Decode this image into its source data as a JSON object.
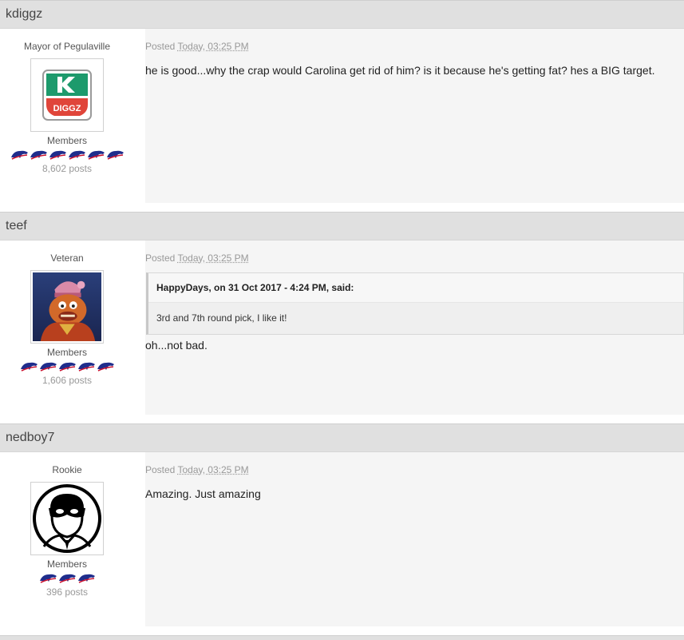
{
  "posts": [
    {
      "username": "kdiggz",
      "rank": "Mayor of Pegulaville",
      "avatar_icon": "kdiggz-logo-icon",
      "group": "Members",
      "pips": 6,
      "postcount": "8,602 posts",
      "posted_label": "Posted",
      "posted_time": "Today, 03:25 PM",
      "message": "he is good...why the crap would Carolina get rid of him?  is it because he's getting fat?  hes a BIG target."
    },
    {
      "username": "teef",
      "rank": "Veteran",
      "avatar_icon": "muppet-avatar-icon",
      "group": "Members",
      "pips": 5,
      "postcount": "1,606 posts",
      "posted_label": "Posted",
      "posted_time": "Today, 03:25 PM",
      "quote_cite": "HappyDays, on 31 Oct 2017 - 4:24 PM, said:",
      "quote_text": "3rd and 7th round pick, I like it!",
      "message": "oh...not bad."
    },
    {
      "username": "nedboy7",
      "rank": "Rookie",
      "avatar_icon": "masked-face-avatar-icon",
      "group": "Members",
      "pips": 3,
      "postcount": "396 posts",
      "posted_label": "Posted",
      "posted_time": "Today, 03:25 PM",
      "message": "Amazing. Just amazing"
    }
  ],
  "colors": {
    "header_bg": "#e0e0e0",
    "content_bg": "#f5f5f5",
    "pip_blue": "#1f2d8c",
    "pip_red": "#c8102e",
    "logo_green": "#1d9a6c",
    "logo_red": "#e0453a"
  }
}
